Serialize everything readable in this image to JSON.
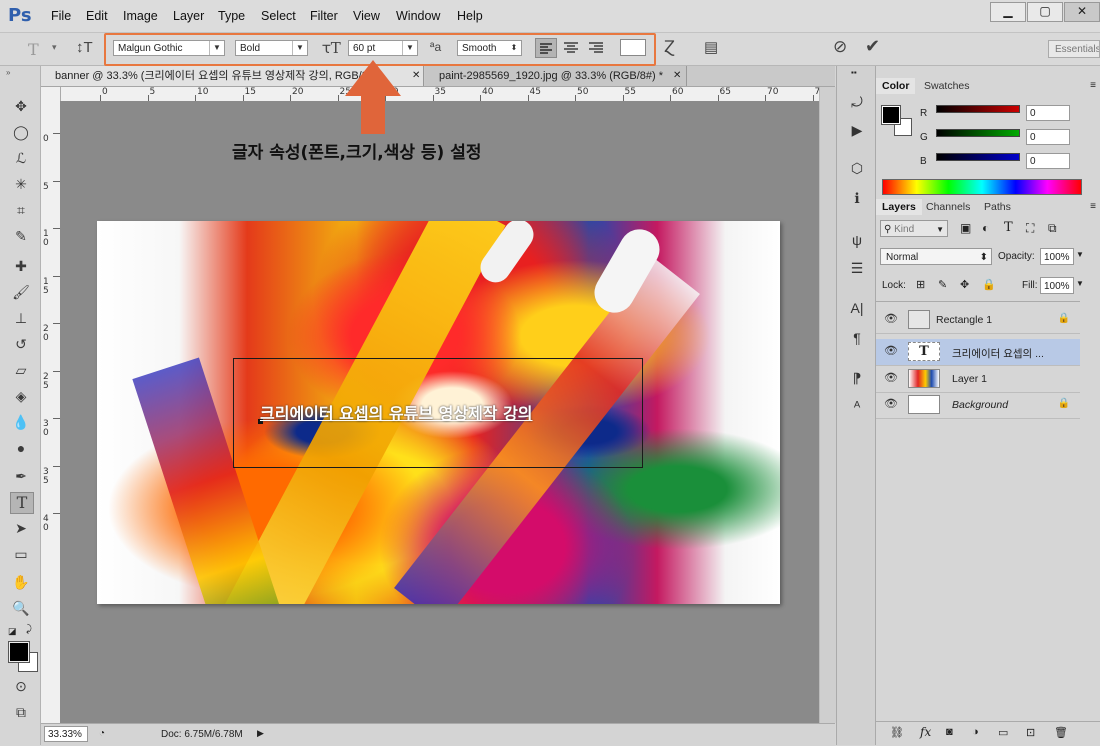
{
  "menu": [
    "File",
    "Edit",
    "Image",
    "Layer",
    "Type",
    "Select",
    "Filter",
    "View",
    "Window",
    "Help"
  ],
  "app_logo": "Ps",
  "window_controls": [
    "▁",
    "▢",
    "✕"
  ],
  "options": {
    "font_family": "Malgun Gothic",
    "font_style": "Bold",
    "font_size": "60 pt",
    "antialias": "Smooth",
    "workspace": "Essentials",
    "cancel_icon": "cancel-icon",
    "commit_icon": "check-icon",
    "highlight_color": "#e8773f"
  },
  "tabs": [
    {
      "label": "banner @ 33.3% (크리에이터 요셉의 유튜브 영상제작 강의, RGB/8) *",
      "active": true
    },
    {
      "label": "paint-2985569_1920.jpg @ 33.3% (RGB/8#) *",
      "active": false
    }
  ],
  "ruler": {
    "top": [
      "0",
      "5",
      "10",
      "15",
      "20",
      "25",
      "30",
      "35",
      "40",
      "45",
      "50",
      "55",
      "60",
      "65",
      "70",
      "75"
    ],
    "left": [
      "0",
      "5",
      "1\n0",
      "1\n5",
      "2\n0",
      "2\n5",
      "3\n0",
      "3\n5",
      "4\n0"
    ]
  },
  "annotation": "글자 속성(폰트,크기,색상 등) 설정",
  "artwork_text": "크리에이터 요셉의 유튜브 영상제작 강의",
  "status": {
    "zoom": "33.33%",
    "doc": "Doc: 6.75M/6.78M"
  },
  "color_panel": {
    "tabs": [
      "Color",
      "Swatches"
    ],
    "channels": [
      {
        "label": "R",
        "value": "0",
        "color": "#cc0000"
      },
      {
        "label": "G",
        "value": "0",
        "color": "#00aa00"
      },
      {
        "label": "B",
        "value": "0",
        "color": "#0000cc"
      }
    ]
  },
  "layers_panel": {
    "tabs": [
      "Layers",
      "Channels",
      "Paths"
    ],
    "kind_label": "Kind",
    "blend_mode": "Normal",
    "opacity_label": "Opacity:",
    "opacity": "100%",
    "lock_label": "Lock:",
    "fill_label": "Fill:",
    "fill": "100%",
    "layers": [
      {
        "name": "Rectangle 1",
        "locked": true,
        "selected": false
      },
      {
        "name": "크리에이터 요셉의 ...",
        "locked": false,
        "selected": true
      },
      {
        "name": "Layer 1",
        "locked": false,
        "selected": false
      },
      {
        "name": "Background",
        "locked": true,
        "selected": false
      }
    ]
  }
}
